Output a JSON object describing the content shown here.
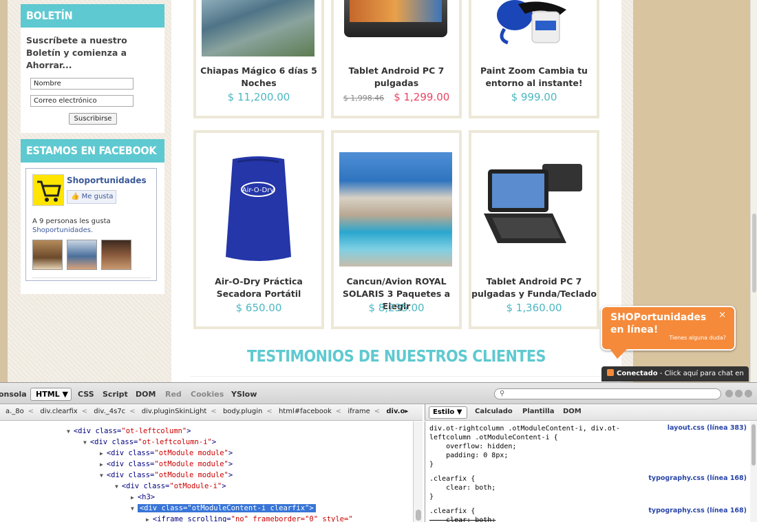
{
  "newsletter": {
    "title": "BOLETÍN",
    "text": "Suscríbete a nuestro Boletín y comienza a Ahorrar...",
    "name_field": "Nombre",
    "email_field": "Correo electrónico",
    "submit_label": "Suscribirse"
  },
  "facebook": {
    "title": "ESTAMOS EN FACEBOOK",
    "page_name": "Shoportunidades",
    "like_label": "Me gusta",
    "count_text": "A 9 personas les gusta",
    "count_page": "Shoportunidades."
  },
  "products_row1": [
    {
      "name": "Chiapas Mágico 6 días 5 Noches",
      "price": "$ 11,200.00"
    },
    {
      "name": "Tablet Android PC 7 pulgadas",
      "old_price": "$ 1,998.46",
      "price": "$ 1,299.00"
    },
    {
      "name": "Paint Zoom Cambia tu entorno al instante!",
      "price": "$ 999.00"
    }
  ],
  "products_row2": [
    {
      "name": "Air-O-Dry Práctica Secadora Portátil",
      "price": "$ 650.00"
    },
    {
      "name": "Cancun/Avion ROYAL SOLARIS 3 Paquetes a Elegir",
      "price": "$ 8,235.00"
    },
    {
      "name": "Tablet Android PC 7 pulgadas y Funda/Teclado",
      "price": "$ 1,360.00"
    }
  ],
  "testimonials_title": "TESTIMONIOS DE NUESTROS CLIENTES",
  "chat": {
    "title": "SHOPortunidades en línea!",
    "close": "×",
    "subtitle": "Tienes alguna duda?",
    "bar_status": "Conectado",
    "bar_text": " - Click aquí para chat en"
  },
  "devtools": {
    "tabs": [
      "onsola",
      "HTML ▼",
      "CSS",
      "Script",
      "DOM",
      "Red",
      "Cookies",
      "YSlow"
    ],
    "breadcrumbs": [
      "a._8o",
      "div.clearfix",
      "div._4s7c",
      "div.pluginSkinLight",
      "body.plugin",
      "html#facebook",
      "iframe",
      "div.o▸"
    ],
    "side_tabs": [
      "Estilo ▼",
      "Calculado",
      "Plantilla",
      "DOM"
    ],
    "tree": [
      {
        "tw": "▼",
        "a": "<div ",
        "b": "class=",
        "c": "\"ot-leftcolumn\"",
        "d": ">"
      },
      {
        "tw": "▼",
        "a": "<div ",
        "b": "class=",
        "c": "\"ot-leftcolumn-i\"",
        "d": ">"
      },
      {
        "tw": "▶",
        "a": "<div ",
        "b": "class=",
        "c": "\"otModule module\"",
        "d": ">"
      },
      {
        "tw": "▶",
        "a": "<div ",
        "b": "class=",
        "c": "\"otModule module\"",
        "d": ">"
      },
      {
        "tw": "▼",
        "a": "<div ",
        "b": "class=",
        "c": "\"otModule module\"",
        "d": ">"
      },
      {
        "tw": "▼",
        "a": "<div ",
        "b": "class=",
        "c": "\"otModule-i\"",
        "d": ">"
      },
      {
        "tw": "▶",
        "a": "<h3>",
        "b": "",
        "c": "",
        "d": ""
      },
      {
        "tw": "▼",
        "a": "<div ",
        "b": "class=",
        "c": "\"otModuleContent-i clearfix\"",
        "d": ">"
      },
      {
        "tw": "▶",
        "a": "<iframe ",
        "b": "scrolling=",
        "c": "\"no\" ",
        "d": "frameborder=\"0\" style=\""
      }
    ],
    "css_rules": [
      "div.ot-rightcolumn .otModuleContent-i, div.ot-",
      "leftcolumn .otModuleContent-i {",
      "    overflow: hidden;",
      "    padding: 0 8px;",
      "}",
      ".clearfix {",
      "    clear: both;",
      "}",
      ".clearfix {",
      "    clear: both;"
    ],
    "css_sources": [
      "layout.css (línea 383)",
      "typography.css (línea 168)",
      "typography.css (línea 168)"
    ]
  }
}
